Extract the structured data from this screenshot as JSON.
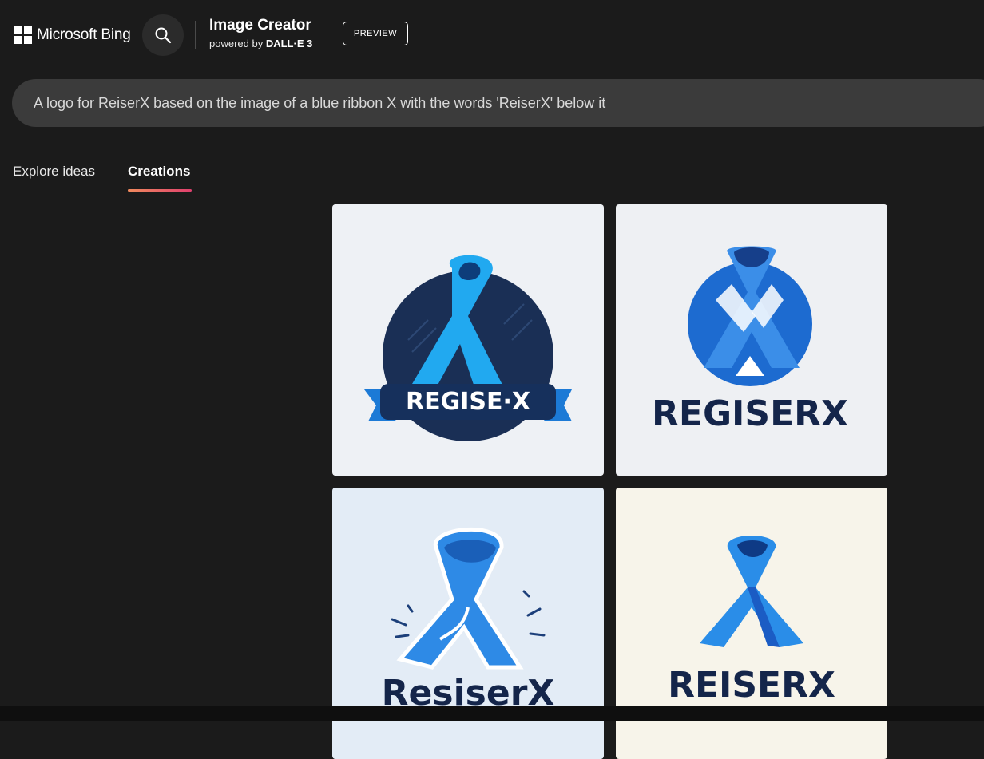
{
  "header": {
    "brand": "Microsoft Bing",
    "app_title": "Image Creator",
    "powered_prefix": "powered by",
    "powered_model": "DALL·E 3",
    "preview_label": "PREVIEW"
  },
  "prompt": {
    "text": "A logo for ReiserX based on the image of a blue ribbon X with the words 'ReiserX' below it"
  },
  "tabs": [
    {
      "label": "Explore ideas",
      "active": false
    },
    {
      "label": "Creations",
      "active": true
    }
  ],
  "images": [
    {
      "logo_text": "REGISE·X"
    },
    {
      "logo_text": "REGISERX"
    },
    {
      "logo_text": "ResiserX"
    },
    {
      "logo_text": "REISERX"
    }
  ],
  "colors": {
    "page_bg": "#1b1b1b",
    "prompt_bg": "#3b3b3b",
    "tab_underline": "#e0406e",
    "ribbon_blue": "#1e7be0",
    "logo_navy": "#14254a"
  },
  "icons": {
    "search": "search-icon",
    "brand": "microsoft-logo-icon"
  }
}
